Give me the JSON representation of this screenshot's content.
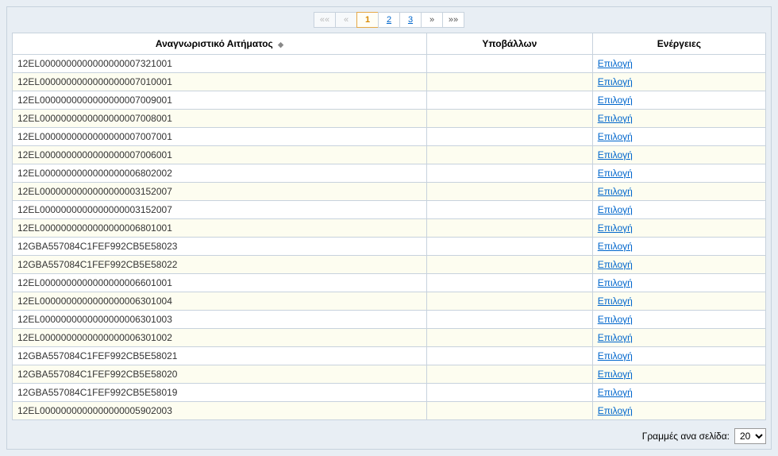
{
  "pagination": {
    "first": "««",
    "prev": "«",
    "next": "»",
    "last": "»»",
    "pages": [
      "1",
      "2",
      "3"
    ],
    "active_index": 0
  },
  "columns": {
    "id": "Αναγνωριστικό Αιτήματος",
    "submitter": "Υποβάλλων",
    "actions": "Ενέργειες"
  },
  "action_label": "Επιλογή",
  "rows": [
    {
      "id": "12EL0000000000000000007321001",
      "submitter": ""
    },
    {
      "id": "12EL0000000000000000007010001",
      "submitter": ""
    },
    {
      "id": "12EL0000000000000000007009001",
      "submitter": ""
    },
    {
      "id": "12EL0000000000000000007008001",
      "submitter": ""
    },
    {
      "id": "12EL0000000000000000007007001",
      "submitter": ""
    },
    {
      "id": "12EL0000000000000000007006001",
      "submitter": ""
    },
    {
      "id": "12EL0000000000000000006802002",
      "submitter": ""
    },
    {
      "id": "12EL0000000000000000003152007",
      "submitter": ""
    },
    {
      "id": "12EL0000000000000000003152007",
      "submitter": ""
    },
    {
      "id": "12EL0000000000000000006801001",
      "submitter": ""
    },
    {
      "id": "12GBA557084C1FEF992CB5E58023",
      "submitter": ""
    },
    {
      "id": "12GBA557084C1FEF992CB5E58022",
      "submitter": ""
    },
    {
      "id": "12EL0000000000000000006601001",
      "submitter": ""
    },
    {
      "id": "12EL0000000000000000006301004",
      "submitter": ""
    },
    {
      "id": "12EL0000000000000000006301003",
      "submitter": ""
    },
    {
      "id": "12EL0000000000000000006301002",
      "submitter": ""
    },
    {
      "id": "12GBA557084C1FEF992CB5E58021",
      "submitter": ""
    },
    {
      "id": "12GBA557084C1FEF992CB5E58020",
      "submitter": ""
    },
    {
      "id": "12GBA557084C1FEF992CB5E58019",
      "submitter": ""
    },
    {
      "id": "12EL0000000000000000005902003",
      "submitter": ""
    }
  ],
  "footer": {
    "rows_per_page_label": "Γραμμές ανα σελίδα:",
    "rows_per_page_value": "20"
  }
}
